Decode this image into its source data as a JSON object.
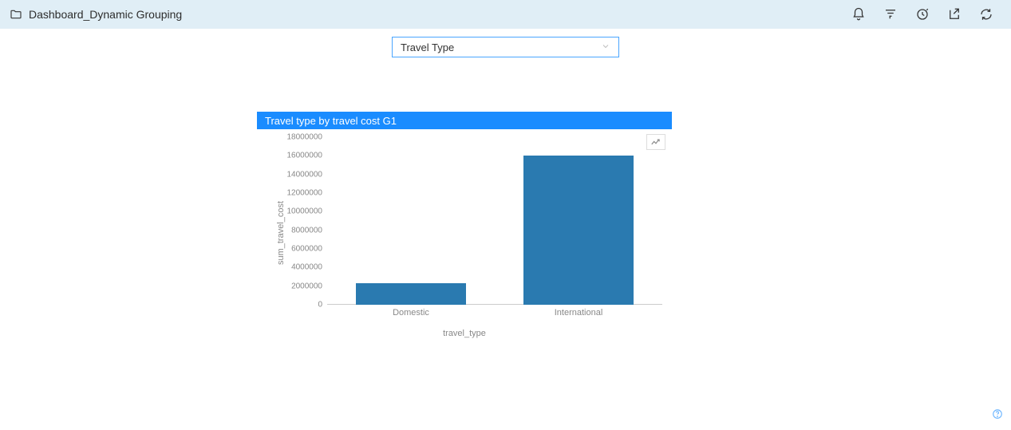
{
  "header": {
    "title": "Dashboard_Dynamic Grouping"
  },
  "filter": {
    "selected": "Travel Type"
  },
  "chart": {
    "title": "Travel type by travel cost G1"
  },
  "chart_data": {
    "type": "bar",
    "title": "Travel type by travel cost G1",
    "categories": [
      "Domestic",
      "International"
    ],
    "values": [
      2300000,
      16000000
    ],
    "xlabel": "travel_type",
    "ylabel": "sum_travel_cost",
    "ylim": [
      0,
      18000000
    ],
    "yticks": [
      0,
      2000000,
      4000000,
      6000000,
      8000000,
      10000000,
      12000000,
      14000000,
      16000000,
      18000000
    ]
  },
  "colors": {
    "accent": "#1a8cff",
    "bar": "#2a7ab0",
    "header_bg": "#e0eef6"
  }
}
